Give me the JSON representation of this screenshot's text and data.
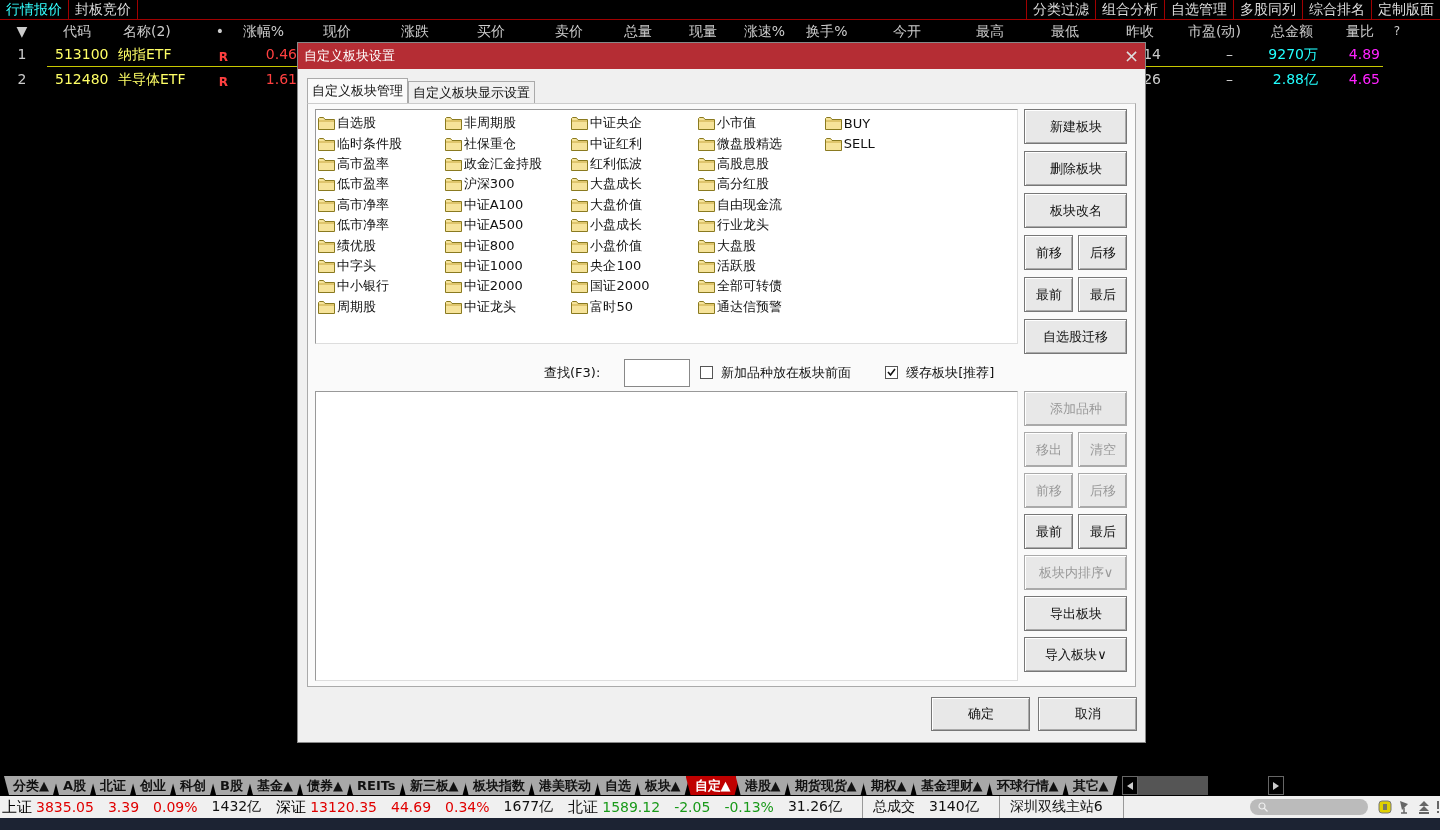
{
  "top_tabs": {
    "left": [
      {
        "label": "行情报价",
        "selected": true
      },
      {
        "label": "封板竞价",
        "selected": false
      }
    ],
    "right": [
      "分类过滤",
      "组合分析",
      "自选管理",
      "多股同列",
      "综合排名",
      "定制版面"
    ]
  },
  "table": {
    "sort_marker": "▼",
    "columns": [
      "代码",
      "名称(2)",
      "•",
      "涨幅%",
      "现价",
      "涨跌",
      "买价",
      "卖价",
      "总量",
      "现量",
      "涨速%",
      "换手%",
      "今开",
      "最高",
      "最低",
      "昨收",
      "市盈(动)",
      "总金额",
      "量比",
      "?"
    ],
    "rows": [
      {
        "index": "1",
        "code": "513100",
        "name": "纳指ETF",
        "flag": "R",
        "change_pct": "0.46",
        "prev_close_tail": "14",
        "pe": "–",
        "amount": "9270万",
        "volume_ratio": "4.89"
      },
      {
        "index": "2",
        "code": "512480",
        "name": "半导体ETF",
        "flag": "R",
        "change_pct": "1.61",
        "prev_close_tail": "26",
        "pe": "–",
        "amount": "2.88亿",
        "volume_ratio": "4.65"
      }
    ]
  },
  "dialog": {
    "title": "自定义板块设置",
    "close": "×",
    "tabs": [
      {
        "label": "自定义板块管理",
        "selected": true
      },
      {
        "label": "自定义板块显示设置",
        "selected": false
      }
    ],
    "blocks": [
      "自选股",
      "临时条件股",
      "高市盈率",
      "低市盈率",
      "高市净率",
      "低市净率",
      "绩优股",
      "中字头",
      "中小银行",
      "周期股",
      "非周期股",
      "社保重仓",
      "政金汇金持股",
      "沪深300",
      "中证A100",
      "中证A500",
      "中证800",
      "中证1000",
      "中证2000",
      "中证龙头",
      "中证央企",
      "中证红利",
      "红利低波",
      "大盘成长",
      "大盘价值",
      "小盘成长",
      "小盘价值",
      "央企100",
      "国证2000",
      "富时50",
      "小市值",
      "微盘股精选",
      "高股息股",
      "高分红股",
      "自由现金流",
      "行业龙头",
      "大盘股",
      "活跃股",
      "全部可转债",
      "通达信预警",
      "BUY",
      "SELL"
    ],
    "block_buttons": [
      {
        "label": "新建板块",
        "kind": "wide",
        "disabled": false
      },
      {
        "label": "删除板块",
        "kind": "wide",
        "disabled": false
      },
      {
        "label": "板块改名",
        "kind": "wide",
        "disabled": false
      },
      {
        "label": "前移",
        "kind": "half",
        "disabled": false
      },
      {
        "label": "后移",
        "kind": "half",
        "disabled": false
      },
      {
        "label": "最前",
        "kind": "half",
        "disabled": false
      },
      {
        "label": "最后",
        "kind": "half",
        "disabled": false
      },
      {
        "label": "自选股迁移",
        "kind": "wide",
        "disabled": false
      }
    ],
    "search": {
      "label": "查找(F3):"
    },
    "checkboxes": [
      {
        "label": "新加品种放在板块前面",
        "checked": false
      },
      {
        "label": "缓存板块[推荐]",
        "checked": true
      }
    ],
    "item_buttons": [
      {
        "label": "添加品种",
        "kind": "wide",
        "disabled": true
      },
      {
        "label": "移出",
        "kind": "half",
        "disabled": true
      },
      {
        "label": "清空",
        "kind": "half",
        "disabled": true
      },
      {
        "label": "前移",
        "kind": "half",
        "disabled": true
      },
      {
        "label": "后移",
        "kind": "half",
        "disabled": true
      },
      {
        "label": "最前",
        "kind": "half",
        "disabled": false
      },
      {
        "label": "最后",
        "kind": "half",
        "disabled": false
      },
      {
        "label": "板块内排序∨",
        "kind": "wide",
        "disabled": true
      },
      {
        "label": "导出板块",
        "kind": "wide",
        "disabled": false
      },
      {
        "label": "导入板块∨",
        "kind": "wide",
        "disabled": false
      }
    ],
    "footer_buttons": [
      "确定",
      "取消"
    ]
  },
  "bottom_tabs": [
    {
      "label": "分类▲",
      "selected": false
    },
    {
      "label": "A股",
      "selected": false
    },
    {
      "label": "北证",
      "selected": false
    },
    {
      "label": "创业",
      "selected": false
    },
    {
      "label": "科创",
      "selected": false
    },
    {
      "label": "B股",
      "selected": false
    },
    {
      "label": "基金▲",
      "selected": false
    },
    {
      "label": "债券▲",
      "selected": false
    },
    {
      "label": "REITs",
      "selected": false
    },
    {
      "label": "新三板▲",
      "selected": false
    },
    {
      "label": "板块指数",
      "selected": false
    },
    {
      "label": "港美联动",
      "selected": false
    },
    {
      "label": "自选",
      "selected": false
    },
    {
      "label": "板块▲",
      "selected": false
    },
    {
      "label": "自定▲",
      "selected": true
    },
    {
      "label": "港股▲",
      "selected": false
    },
    {
      "label": "期货现货▲",
      "selected": false
    },
    {
      "label": "期权▲",
      "selected": false
    },
    {
      "label": "基金理财▲",
      "selected": false
    },
    {
      "label": "环球行情▲",
      "selected": false
    },
    {
      "label": "其它▲",
      "selected": false
    }
  ],
  "status_bar": {
    "groups": [
      [
        {
          "text": "上证",
          "color": "#000000"
        },
        {
          "text": "3835.05",
          "color": "#e00000"
        },
        {
          "text": "3.39",
          "color": "#e00000"
        },
        {
          "text": "0.09%",
          "color": "#e00000"
        },
        {
          "text": "1432亿",
          "color": "#111111"
        },
        {
          "text": "深证",
          "color": "#000000"
        },
        {
          "text": "13120.35",
          "color": "#e00000"
        },
        {
          "text": "44.69",
          "color": "#e00000"
        },
        {
          "text": "0.34%",
          "color": "#e00000"
        },
        {
          "text": "1677亿",
          "color": "#111111"
        },
        {
          "text": "北证",
          "color": "#111111"
        },
        {
          "text": "1589.12",
          "color": "#1a9a1a"
        },
        {
          "text": "-2.05",
          "color": "#1a9a1a"
        },
        {
          "text": "-0.13%",
          "color": "#1a9a1a"
        },
        {
          "text": "31.26亿",
          "color": "#111111"
        }
      ],
      [
        {
          "text": "总成交",
          "color": "#111111"
        },
        {
          "text": "3140亿",
          "color": "#111111"
        }
      ],
      [
        {
          "text": "深圳双线主站6",
          "color": "#111111"
        }
      ]
    ]
  }
}
